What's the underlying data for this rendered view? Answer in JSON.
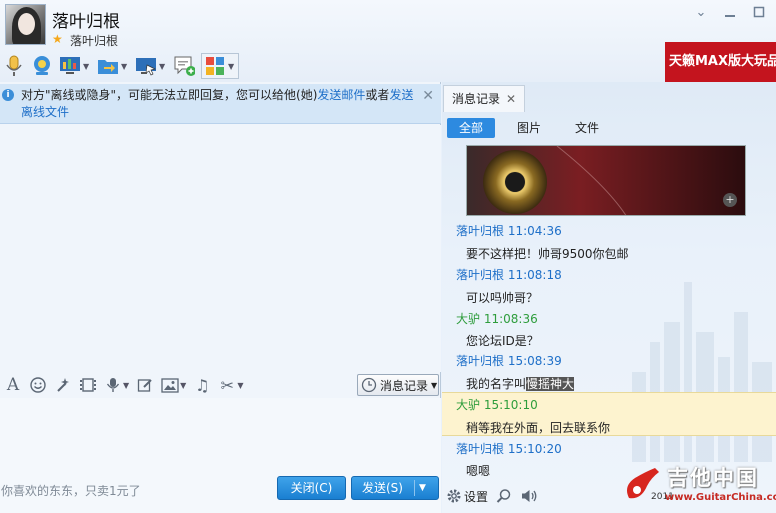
{
  "contact": {
    "name": "落叶归根",
    "signature": "落叶归根"
  },
  "window_controls": [
    "chevron-down",
    "minimize",
    "maximize"
  ],
  "toolbar": {
    "items": [
      "microphone-icon",
      "video-camera-icon",
      "screen-share-icon",
      "file-transfer-icon",
      "remote-assist-icon",
      "add-message-icon",
      "apps-grid-icon"
    ]
  },
  "ad": {
    "text": "天籁MAX版大玩品"
  },
  "notice": {
    "prefix": "对方\"离线或隐身\"，可能无法立即回复，您可以给他(她)",
    "link1": "发送邮件",
    "middle": "或者",
    "link2": "发送离线文件"
  },
  "input_toolbar": {
    "history_button": "消息记录"
  },
  "footer": {
    "hint": "你喜欢的东东，只卖1元了",
    "close_label": "关闭(C)",
    "send_label": "发送(S)"
  },
  "history_panel": {
    "tab_label": "消息记录",
    "filters": [
      "全部",
      "图片",
      "文件"
    ],
    "active_filter": "全部",
    "messages": [
      {
        "sender": "落叶归根",
        "time": "11:04:36",
        "text": "要不这样把！帅哥9500你包邮",
        "self": false
      },
      {
        "sender": "落叶归根",
        "time": "11:08:18",
        "text": "可以吗帅哥？",
        "self": false
      },
      {
        "sender": "大驴",
        "time": "11:08:36",
        "text": "您论坛ID是？",
        "self": true
      },
      {
        "sender": "落叶归根",
        "time": "15:08:39",
        "text_prefix": "我的名字叫",
        "text_highlight": "慢摇神大",
        "self": false
      },
      {
        "sender": "大驴",
        "time": "15:10:10",
        "text": "稍等我在外面，回去联系你",
        "self": true
      },
      {
        "sender": "落叶归根",
        "time": "15:10:20",
        "text": "嗯嗯",
        "self": false
      }
    ],
    "bottom": {
      "settings_label": "设置"
    }
  },
  "colors": {
    "other_sender": "#1e6fc8",
    "self_sender": "#2e9d3c",
    "link": "#1e6fc8",
    "button_blue": "#1a7fd1",
    "highlight_row": "#fdf3cf"
  },
  "watermark": {
    "text": "吉他中国",
    "url": "www.GuitarChina.com",
    "year": "2011"
  }
}
